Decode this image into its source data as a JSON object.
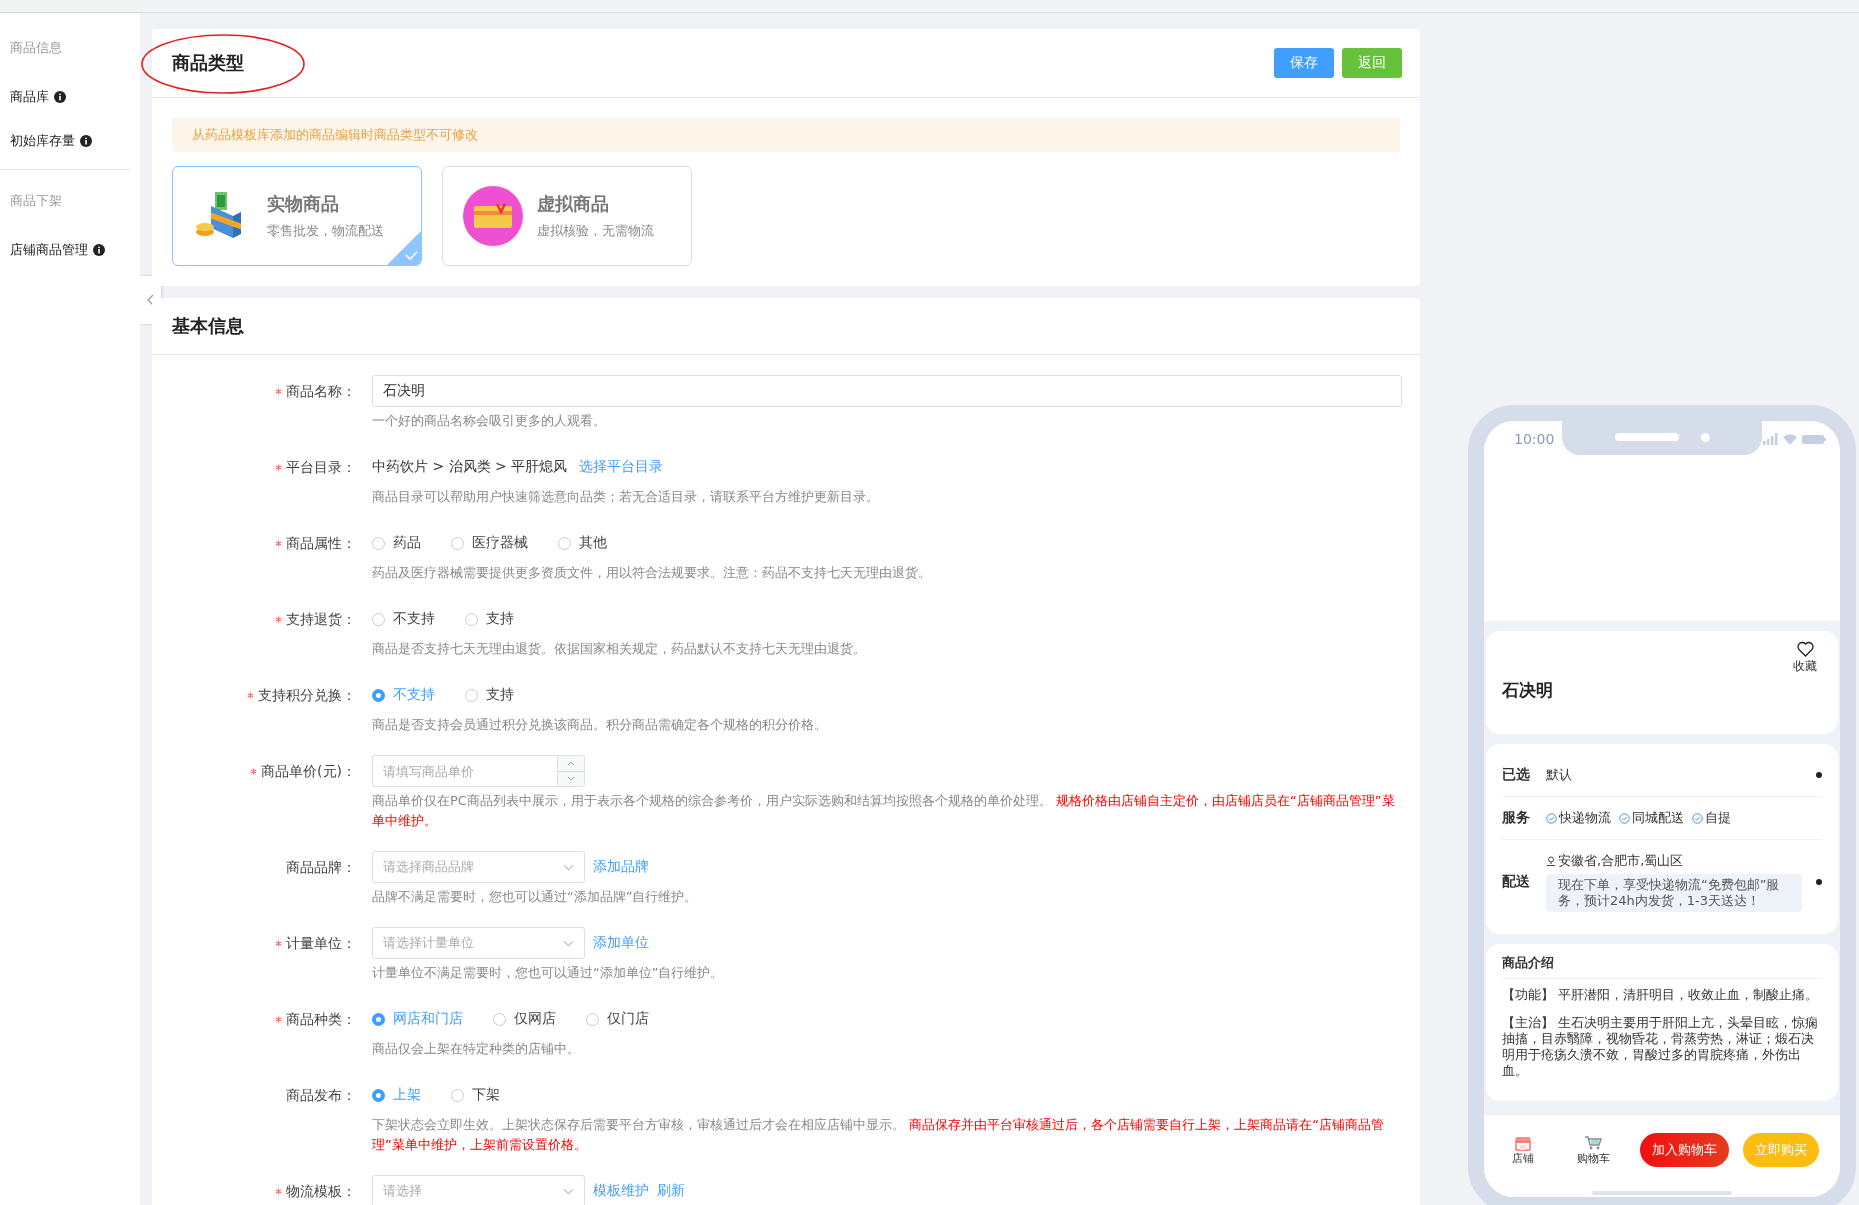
{
  "sidebar": {
    "groups": [
      {
        "title": "商品信息",
        "items": [
          {
            "label": "商品库",
            "info": true
          },
          {
            "label": "初始库存量",
            "info": true
          }
        ]
      },
      {
        "title": "商品下架",
        "items": [
          {
            "label": "店铺商品管理",
            "info": true
          }
        ]
      }
    ]
  },
  "type_section": {
    "title": "商品类型",
    "annotated": true,
    "buttons": [
      {
        "label": "保存",
        "kind": "primary"
      },
      {
        "label": "返回",
        "kind": "success"
      }
    ],
    "notice": "从药品模板库添加的商品编辑时商品类型不可修改",
    "options": [
      {
        "kind": "physical",
        "title": "实物商品",
        "subtitle": "零售批发，物流配送",
        "selected": true
      },
      {
        "kind": "virtual",
        "title": "虚拟商品",
        "subtitle": "虚拟核验，无需物流",
        "selected": false
      }
    ]
  },
  "basic_section": {
    "title": "基本信息",
    "fields": [
      {
        "kind": "input",
        "label": "商品名称：",
        "required": true,
        "value": "石决明",
        "help": "一个好的商品名称会吸引更多的人观看。"
      },
      {
        "kind": "path",
        "label": "平台目录：",
        "required": true,
        "value": "中药饮片 > 治风类 > 平肝熄风",
        "links": [
          "选择平台目录"
        ],
        "help": "商品目录可以帮助用户快速筛选意向品类；若无合适目录，请联系平台方维护更新目录。"
      },
      {
        "kind": "radio",
        "label": "商品属性：",
        "required": true,
        "options": [
          {
            "label": "药品",
            "selected": false
          },
          {
            "label": "医疗器械",
            "selected": false
          },
          {
            "label": "其他",
            "selected": false
          }
        ],
        "help": "药品及医疗器械需要提供更多资质文件，用以符合法规要求。注意：药品不支持七天无理由退货。"
      },
      {
        "kind": "radio",
        "label": "支持退货：",
        "required": true,
        "options": [
          {
            "label": "不支持",
            "selected": false
          },
          {
            "label": "支持",
            "selected": false
          }
        ],
        "help": "商品是否支持七天无理由退货。依据国家相关规定，药品默认不支持七天无理由退货。"
      },
      {
        "kind": "radio",
        "label": "支持积分兑换：",
        "required": true,
        "options": [
          {
            "label": "不支持",
            "selected": true
          },
          {
            "label": "支持",
            "selected": false
          }
        ],
        "help": "商品是否支持会员通过积分兑换该商品。积分商品需确定各个规格的积分价格。"
      },
      {
        "kind": "number",
        "label": "商品单价(元)：",
        "required": true,
        "placeholder": "请填写商品单价",
        "help": "商品单价仅在PC商品列表中展示，用于表示各个规格的综合参考价，用户实际选购和结算均按照各个规格的单价处理。",
        "warning": "规格价格由店铺自主定价，由店铺店员在“店铺商品管理”菜单中维护。"
      },
      {
        "kind": "select",
        "label": "商品品牌：",
        "required": false,
        "placeholder": "请选择商品品牌",
        "links": [
          "添加品牌"
        ],
        "help": "品牌不满足需要时，您也可以通过“添加品牌”自行维护。"
      },
      {
        "kind": "select",
        "label": "计量单位：",
        "required": true,
        "placeholder": "请选择计量单位",
        "links": [
          "添加单位"
        ],
        "help": "计量单位不满足需要时，您也可以通过“添加单位”自行维护。"
      },
      {
        "kind": "radio",
        "label": "商品种类：",
        "required": true,
        "options": [
          {
            "label": "网店和门店",
            "selected": true
          },
          {
            "label": "仅网店",
            "selected": false
          },
          {
            "label": "仅门店",
            "selected": false
          }
        ],
        "help": "商品仅会上架在特定种类的店铺中。"
      },
      {
        "kind": "radio",
        "label": "商品发布：",
        "required": false,
        "options": [
          {
            "label": "上架",
            "selected": true
          },
          {
            "label": "下架",
            "selected": false
          }
        ],
        "help": "下架状态会立即生效。上架状态保存后需要平台方审核，审核通过后才会在相应店铺中显示。",
        "warning": "商品保存并由平台审核通过后，各个店铺需要自行上架，上架商品请在“店铺商品管理”菜单中维护，上架前需设置价格。"
      },
      {
        "kind": "select",
        "label": "物流模板：",
        "required": true,
        "placeholder": "请选择",
        "links": [
          "模板维护",
          "刷新"
        ]
      }
    ]
  },
  "phone": {
    "time": "10:00",
    "favorite": "收藏",
    "name": "石决明",
    "rows": [
      {
        "kind": "spec",
        "label": "已选",
        "value": "默认"
      },
      {
        "kind": "service",
        "label": "服务",
        "tags": [
          "快递物流",
          "同城配送",
          "自提"
        ]
      },
      {
        "kind": "delivery",
        "label": "配送",
        "address": "安徽省,合肥市,蜀山区",
        "note": "现在下单，享受快递物流“免费包邮”服务，预计24h内发货，1-3天送达！"
      }
    ],
    "intro": {
      "title": "商品介绍",
      "paragraphs": [
        "【功能】 平肝潜阳，清肝明目，收敛止血，制酸止痛。",
        "【主治】 生石决明主要用于肝阳上亢，头晕目眩，惊痫抽搐，目赤翳障，视物昏花，骨蒸劳热，淋证；煅石决明用于疮疡久溃不敛，胃酸过多的胃脘疼痛，外伤出血。"
      ]
    },
    "tabs": [
      {
        "kind": "store",
        "label": "店铺"
      },
      {
        "kind": "cart",
        "label": "购物车"
      }
    ],
    "actions": [
      {
        "kind": "cart",
        "label": "加入购物车"
      },
      {
        "kind": "buy",
        "label": "立即购买"
      }
    ]
  }
}
